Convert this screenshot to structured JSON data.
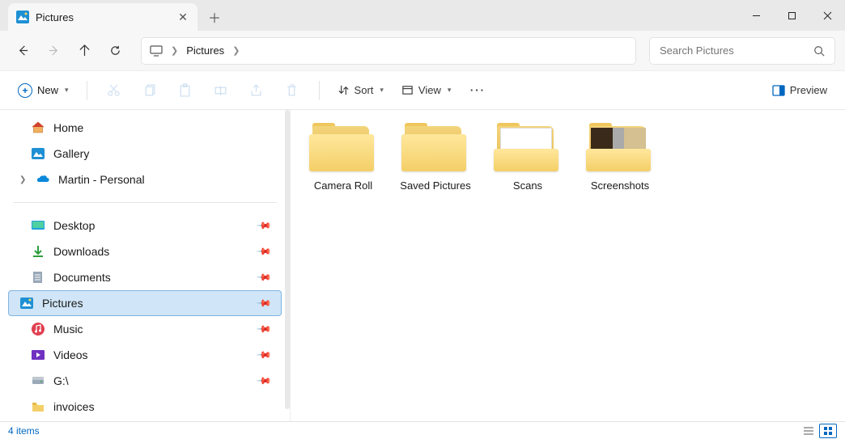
{
  "tab": {
    "title": "Pictures"
  },
  "breadcrumb": {
    "current": "Pictures"
  },
  "search": {
    "placeholder": "Search Pictures"
  },
  "toolbar": {
    "new_label": "New",
    "sort_label": "Sort",
    "view_label": "View",
    "preview_label": "Preview"
  },
  "sidebar": {
    "top": [
      {
        "label": "Home",
        "icon": "home"
      },
      {
        "label": "Gallery",
        "icon": "gallery"
      },
      {
        "label": "Martin - Personal",
        "icon": "onedrive",
        "expandable": true
      }
    ],
    "quick": [
      {
        "label": "Desktop",
        "icon": "desktop"
      },
      {
        "label": "Downloads",
        "icon": "downloads"
      },
      {
        "label": "Documents",
        "icon": "documents"
      },
      {
        "label": "Pictures",
        "icon": "pictures",
        "selected": true
      },
      {
        "label": "Music",
        "icon": "music"
      },
      {
        "label": "Videos",
        "icon": "videos"
      },
      {
        "label": "G:\\",
        "icon": "drive"
      },
      {
        "label": "invoices",
        "icon": "folder"
      }
    ]
  },
  "folders": [
    {
      "label": "Camera Roll",
      "type": "empty"
    },
    {
      "label": "Saved Pictures",
      "type": "empty"
    },
    {
      "label": "Scans",
      "type": "paper"
    },
    {
      "label": "Screenshots",
      "type": "thumb"
    }
  ],
  "status": {
    "text": "4 items"
  }
}
